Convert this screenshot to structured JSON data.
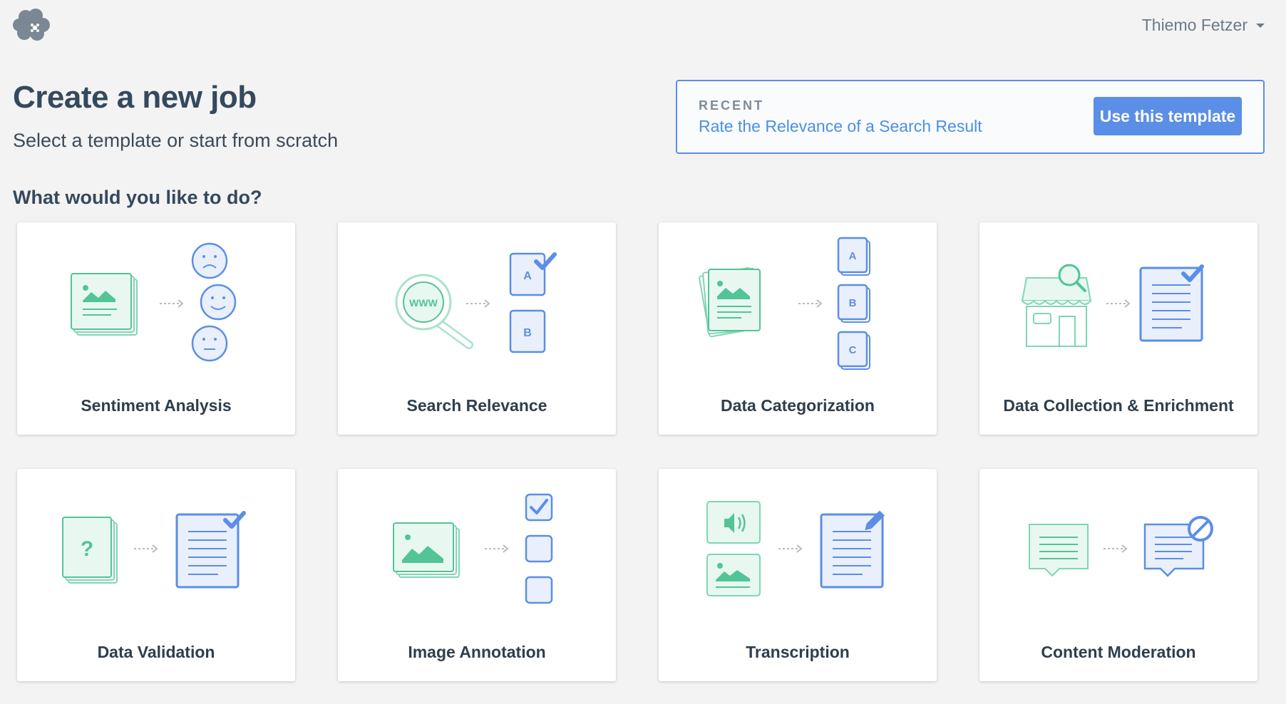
{
  "header": {
    "logo": "cloud-flower-logo",
    "user_name": "Thiemo Fetzer"
  },
  "page": {
    "title": "Create a new job",
    "subtitle": "Select a template or start from scratch",
    "section_heading": "What would you like to do?"
  },
  "recent": {
    "label": "RECENT",
    "template_name": "Rate the Relevance of a Search Result",
    "button_label": "Use this template"
  },
  "colors": {
    "accent_blue": "#5b8ee6",
    "illustration_green": "#52c496",
    "background": "#f3f3f3"
  },
  "templates": [
    {
      "label": "Sentiment Analysis",
      "icon": "sentiment-analysis-illustration"
    },
    {
      "label": "Search Relevance",
      "icon": "search-relevance-illustration"
    },
    {
      "label": "Data Categorization",
      "icon": "data-categorization-illustration"
    },
    {
      "label": "Data Collection & Enrichment",
      "icon": "data-collection-illustration"
    },
    {
      "label": "Data Validation",
      "icon": "data-validation-illustration"
    },
    {
      "label": "Image Annotation",
      "icon": "image-annotation-illustration"
    },
    {
      "label": "Transcription",
      "icon": "transcription-illustration"
    },
    {
      "label": "Content Moderation",
      "icon": "content-moderation-illustration"
    }
  ]
}
